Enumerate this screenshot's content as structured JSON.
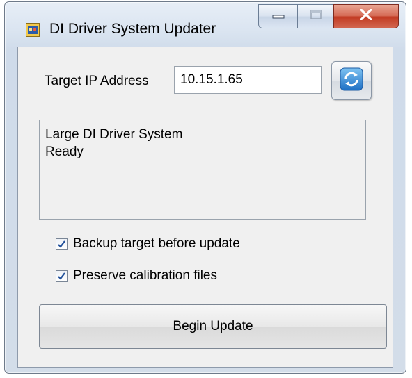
{
  "window": {
    "title": "DI Driver System Updater",
    "icon": "labview-app-icon",
    "caption_buttons": [
      "minimize-icon",
      "maximize-icon",
      "close-icon"
    ]
  },
  "target": {
    "label": "Target IP Address",
    "ip_value": "10.15.1.65",
    "refresh_icon": "refresh-icon"
  },
  "status": {
    "lines": [
      "Large DI Driver System",
      "Ready"
    ]
  },
  "options": {
    "backup_label": "Backup target before update",
    "backup_checked": true,
    "preserve_label": "Preserve calibration files",
    "preserve_checked": true
  },
  "actions": {
    "begin_label": "Begin Update"
  },
  "colors": {
    "close_button": "#c13a22",
    "check_mark": "#1f4f9a"
  }
}
